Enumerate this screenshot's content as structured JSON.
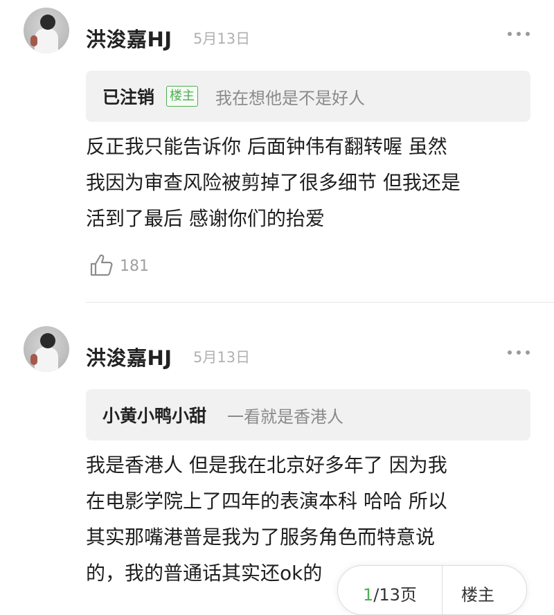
{
  "comments": [
    {
      "username": "洪浚嘉HJ",
      "date": "5月13日",
      "quote": {
        "author": "已注销",
        "badge": "楼主",
        "text": "我在想他是不是好人"
      },
      "body": "反正我只能告诉你 后面钟伟有翻转喔 虽然\n我因为审查风险被剪掉了很多细节 但我还是\n活到了最后 感谢你们的抬爱",
      "likes": "181"
    },
    {
      "username": "洪浚嘉HJ",
      "date": "5月13日",
      "quote": {
        "author": "小黄小鸭小甜",
        "text": "一看就是香港人"
      },
      "body": "我是香港人 但是我在北京好多年了 因为我\n在电影学院上了四年的表演本科 哈哈 所以\n其实那嘴港普是我为了服务角色而特意说\n的，我的普通话其实还ok的"
    }
  ],
  "pager": {
    "current": "1",
    "total": "/13页",
    "op_label": "楼主"
  },
  "icons": [
    "more-icon",
    "thumb-up-icon"
  ],
  "colors": {
    "accent": "#4caf50",
    "muted": "#b0b0b0"
  }
}
